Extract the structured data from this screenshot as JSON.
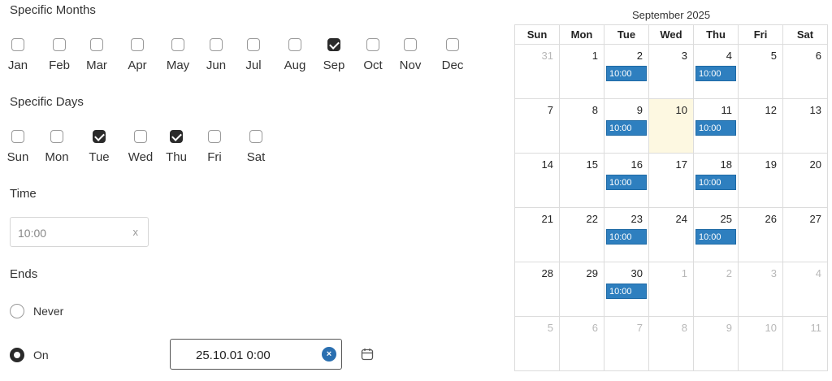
{
  "months": {
    "title": "Specific Months",
    "items": [
      {
        "label": "Jan",
        "checked": false
      },
      {
        "label": "Feb",
        "checked": false
      },
      {
        "label": "Mar",
        "checked": false
      },
      {
        "label": "Apr",
        "checked": false
      },
      {
        "label": "May",
        "checked": false
      },
      {
        "label": "Jun",
        "checked": false
      },
      {
        "label": "Jul",
        "checked": false
      },
      {
        "label": "Aug",
        "checked": false
      },
      {
        "label": "Sep",
        "checked": true
      },
      {
        "label": "Oct",
        "checked": false
      },
      {
        "label": "Nov",
        "checked": false
      },
      {
        "label": "Dec",
        "checked": false
      }
    ]
  },
  "days": {
    "title": "Specific Days",
    "items": [
      {
        "label": "Sun",
        "checked": false
      },
      {
        "label": "Mon",
        "checked": false
      },
      {
        "label": "Tue",
        "checked": true
      },
      {
        "label": "Wed",
        "checked": false
      },
      {
        "label": "Thu",
        "checked": true
      },
      {
        "label": "Fri",
        "checked": false
      },
      {
        "label": "Sat",
        "checked": false
      }
    ]
  },
  "time": {
    "title": "Time",
    "value": "10:00",
    "clear": "x"
  },
  "ends": {
    "title": "Ends",
    "never_label": "Never",
    "on_label": "On",
    "selected": "on",
    "date_value": "25.10.01 0:00",
    "clear": "×"
  },
  "calendar": {
    "title": "September 2025",
    "weekdays": [
      "Sun",
      "Mon",
      "Tue",
      "Wed",
      "Thu",
      "Fri",
      "Sat"
    ],
    "weeks": [
      [
        {
          "d": "31",
          "other": true
        },
        {
          "d": "1"
        },
        {
          "d": "2",
          "event": "10:00"
        },
        {
          "d": "3"
        },
        {
          "d": "4",
          "event": "10:00"
        },
        {
          "d": "5"
        },
        {
          "d": "6"
        }
      ],
      [
        {
          "d": "7"
        },
        {
          "d": "8"
        },
        {
          "d": "9",
          "event": "10:00"
        },
        {
          "d": "10",
          "today": true
        },
        {
          "d": "11",
          "event": "10:00"
        },
        {
          "d": "12"
        },
        {
          "d": "13"
        }
      ],
      [
        {
          "d": "14"
        },
        {
          "d": "15"
        },
        {
          "d": "16",
          "event": "10:00"
        },
        {
          "d": "17"
        },
        {
          "d": "18",
          "event": "10:00"
        },
        {
          "d": "19"
        },
        {
          "d": "20"
        }
      ],
      [
        {
          "d": "21"
        },
        {
          "d": "22"
        },
        {
          "d": "23",
          "event": "10:00"
        },
        {
          "d": "24"
        },
        {
          "d": "25",
          "event": "10:00"
        },
        {
          "d": "26"
        },
        {
          "d": "27"
        }
      ],
      [
        {
          "d": "28"
        },
        {
          "d": "29"
        },
        {
          "d": "30",
          "event": "10:00"
        },
        {
          "d": "1",
          "other": true
        },
        {
          "d": "2",
          "other": true
        },
        {
          "d": "3",
          "other": true
        },
        {
          "d": "4",
          "other": true
        }
      ],
      [
        {
          "d": "5",
          "other": true
        },
        {
          "d": "6",
          "other": true
        },
        {
          "d": "7",
          "other": true
        },
        {
          "d": "8",
          "other": true
        },
        {
          "d": "9",
          "other": true
        },
        {
          "d": "10",
          "other": true
        },
        {
          "d": "11",
          "other": true
        }
      ]
    ]
  },
  "colors": {
    "accent": "#2e7fbf",
    "checked": "#2b2b2b",
    "today": "#fdf8e1"
  }
}
